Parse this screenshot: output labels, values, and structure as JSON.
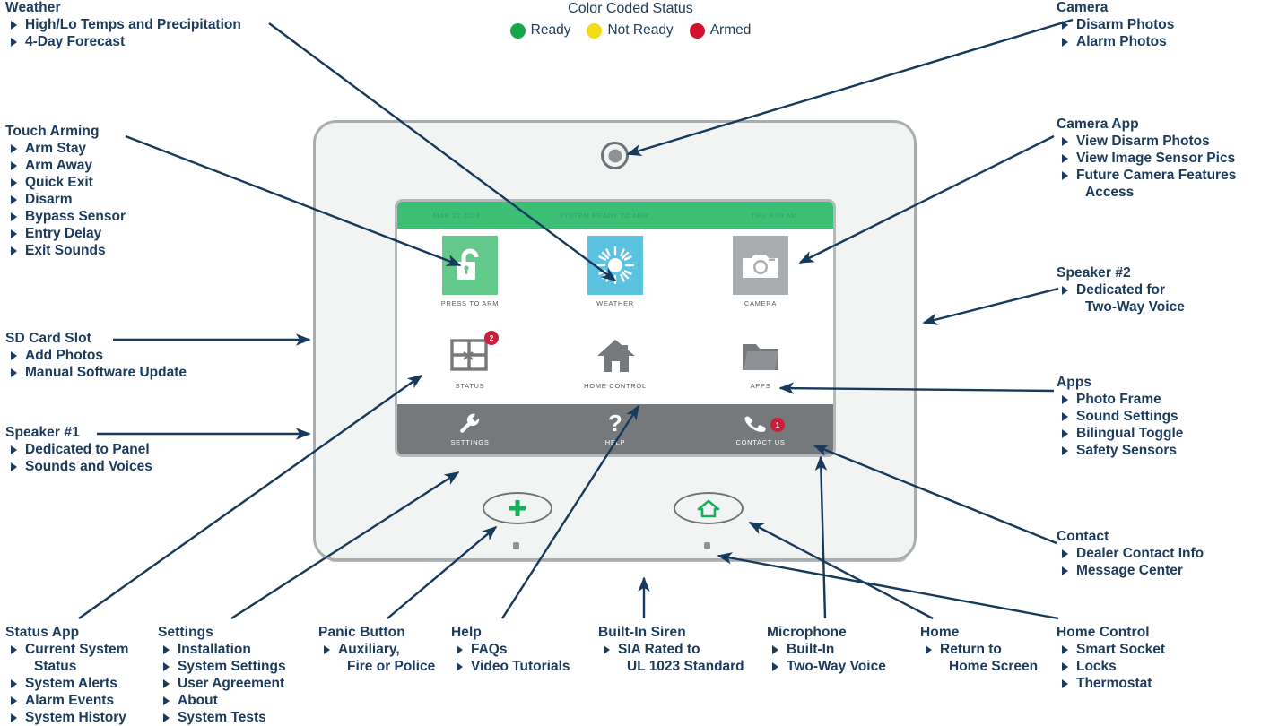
{
  "legend": {
    "title": "Color Coded Status",
    "items": [
      {
        "label": "Ready",
        "color": "#15a84a"
      },
      {
        "label": "Not Ready",
        "color": "#f2dd12"
      },
      {
        "label": "Armed",
        "color": "#d31030"
      }
    ]
  },
  "callouts": {
    "weather": {
      "title": "Weather",
      "items": [
        "High/Lo Temps and Precipitation",
        "4-Day Forecast"
      ]
    },
    "touch_arming": {
      "title": "Touch Arming",
      "items": [
        "Arm Stay",
        "Arm Away",
        "Quick Exit",
        "Disarm",
        "Bypass Sensor",
        "Entry Delay",
        "Exit Sounds"
      ]
    },
    "sd_card": {
      "title": "SD Card Slot",
      "items": [
        "Add Photos",
        "Manual Software Update"
      ]
    },
    "speaker1": {
      "title": "Speaker #1",
      "items": [
        "Dedicated to Panel",
        "Sounds and Voices"
      ]
    },
    "status_app": {
      "title": "Status App",
      "items": [
        "Current System",
        "Status",
        "System Alerts",
        "Alarm Events",
        "System History"
      ]
    },
    "settings": {
      "title": "Settings",
      "items": [
        "Installation",
        "System Settings",
        "User Agreement",
        "About",
        "System Tests"
      ]
    },
    "panic": {
      "title": "Panic Button",
      "items": [
        "Auxiliary,",
        "Fire or Police"
      ]
    },
    "help": {
      "title": "Help",
      "items": [
        "FAQs",
        "Video Tutorials"
      ]
    },
    "siren": {
      "title": "Built-In Siren",
      "items": [
        "SIA Rated to",
        "UL 1023 Standard"
      ]
    },
    "microphone": {
      "title": "Microphone",
      "items": [
        "Built-In",
        "Two-Way Voice"
      ]
    },
    "home": {
      "title": "Home",
      "items": [
        "Return to",
        "Home Screen"
      ]
    },
    "home_control": {
      "title": "Home Control",
      "items": [
        "Smart Socket",
        "Locks",
        "Thermostat"
      ]
    },
    "camera": {
      "title": "Camera",
      "items": [
        "Disarm Photos",
        "Alarm Photos"
      ]
    },
    "camera_app": {
      "title": "Camera App",
      "items": [
        "View Disarm Photos",
        "View Image Sensor Pics",
        "Future Camera Features",
        "Access"
      ]
    },
    "speaker2": {
      "title": "Speaker #2",
      "items": [
        "Dedicated for",
        "Two-Way Voice"
      ]
    },
    "apps": {
      "title": "Apps",
      "items": [
        "Photo Frame",
        "Sound Settings",
        "Bilingual Toggle",
        "Safety Sensors"
      ]
    },
    "contact": {
      "title": "Contact",
      "items": [
        "Dealer Contact Info",
        "Message Center"
      ]
    }
  },
  "panel": {
    "statusbar": {
      "left": "MAR 22 2018",
      "middle": "SYSTEM READY TO ARM",
      "right": "THU   9:09 AM",
      "background": "#3cbe74"
    },
    "tiles_row1": [
      {
        "label": "PRESS TO ARM",
        "icon": "unlock-icon",
        "tile_color": "#62c98b"
      },
      {
        "label": "WEATHER",
        "icon": "sun-icon",
        "tile_color": "#5bc2e0"
      },
      {
        "label": "CAMERA",
        "icon": "camera-icon",
        "tile_color": "#a9adaf"
      }
    ],
    "tiles_row2": [
      {
        "label": "STATUS",
        "icon": "window-grid-icon",
        "badge": "2"
      },
      {
        "label": "HOME CONTROL",
        "icon": "house-icon",
        "badge": ""
      },
      {
        "label": "APPS",
        "icon": "folder-icon",
        "badge": ""
      }
    ],
    "dock": [
      {
        "label": "SETTINGS",
        "icon": "wrench-icon",
        "badge": ""
      },
      {
        "label": "HELP",
        "icon": "question-icon",
        "badge": ""
      },
      {
        "label": "CONTACT US",
        "icon": "phone-icon",
        "badge": "1"
      }
    ],
    "hardware": {
      "panic_button": "panic-plus-icon",
      "home_button": "home-house-icon",
      "camera_lens": "camera-lens",
      "accent_green": "#16b05a"
    }
  }
}
